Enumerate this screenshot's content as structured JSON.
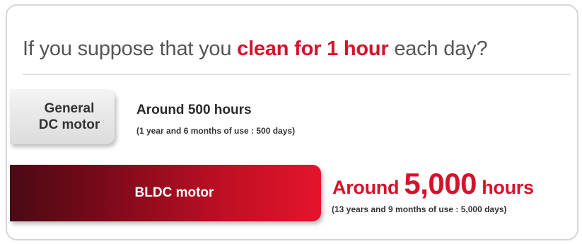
{
  "headline": {
    "prefix": "If you suppose that you ",
    "highlight": "clean for 1 hour",
    "suffix": " each day?"
  },
  "general_dc": {
    "label": "General\nDC motor",
    "value": "Around 500 hours",
    "note": "(1 year and 6 months of use : 500 days)"
  },
  "bldc": {
    "label": "BLDC motor",
    "value_prefix": "Around ",
    "value_number": "5,000",
    "value_suffix": " hours",
    "note": "(13 years and 9 months of use : 5,000 days)"
  },
  "colors": {
    "accent": "#d8112a",
    "bar_dark": "#4a0a14",
    "bar_light": "#e4142c",
    "dc_box": "#dcdcdc"
  }
}
